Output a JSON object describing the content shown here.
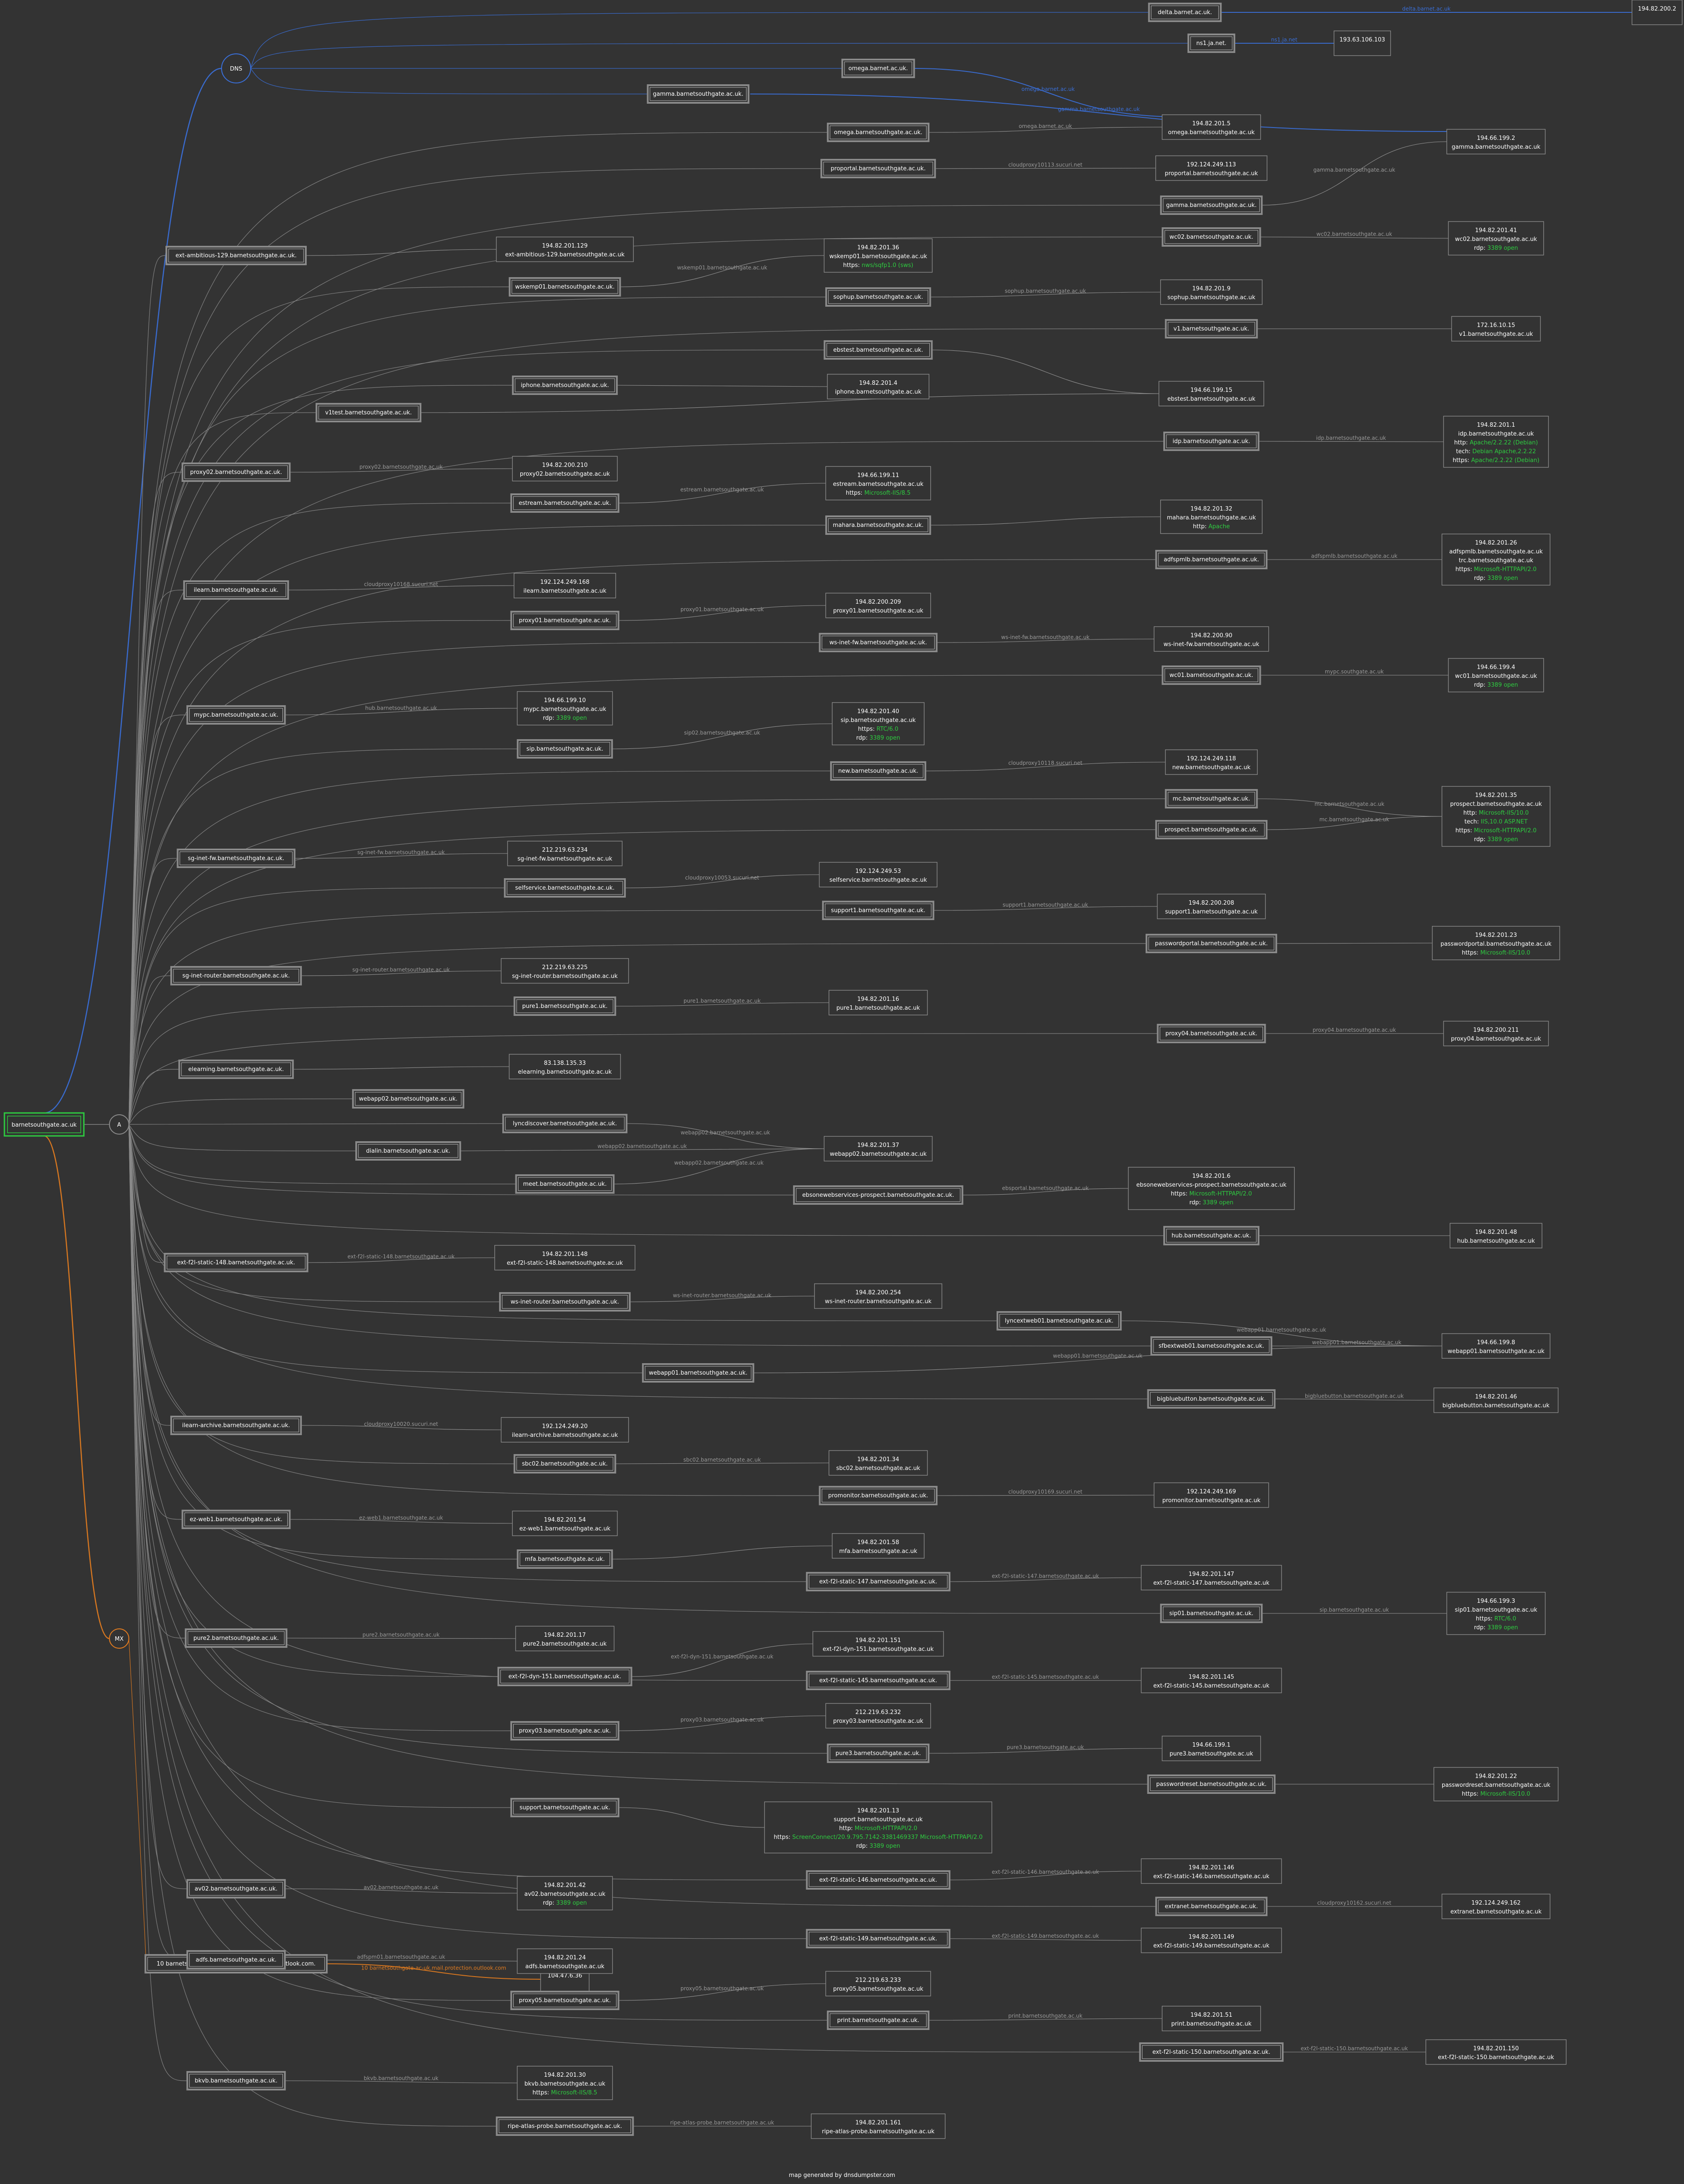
{
  "domain_root": "barnetsouthgate.ac.uk",
  "footer": "map generated by dnsdumpster.com",
  "colors": {
    "dns": "#3a6fd8",
    "mx": "#e07b20",
    "a": "#8a8a8a",
    "green": "#2ecc40",
    "text": "#ffffff",
    "label": "#9a9a9a",
    "bg": "#333333"
  },
  "dns": {
    "hub": "DNS",
    "servers": [
      {
        "host": "delta.barnet.ac.uk.",
        "link": "delta.barnet.ac.uk",
        "ip": "194.82.200.2"
      },
      {
        "host": "ns1.ja.net.",
        "link": "ns1.ja.net",
        "ip": "193.63.106.103"
      },
      {
        "host": "omega.barnet.ac.uk.",
        "link": "omega.barnet.ac.uk"
      },
      {
        "host": "gamma.barnetsouthgate.ac.uk.",
        "link": "gamma.barnetsouthgate.ac.uk"
      }
    ]
  },
  "mx": {
    "hub": "MX",
    "host": "10 barnetsouthgate-ac-uk.mail.protection.outlook.com.",
    "link": "10 barnetsouthgate-ac-uk.mail.protection.outlook.com",
    "ip": "104.47.6.36"
  },
  "a": {
    "hub": "A",
    "hosts": [
      "omega.barnetsouthgate.ac.uk.",
      "proportal.barnetsouthgate.ac.uk.",
      "gamma.barnetsouthgate.ac.uk.",
      "wc02.barnetsouthgate.ac.uk.",
      "ext-ambitious-129.barnetsouthgate.ac.uk.",
      "wskemp01.barnetsouthgate.ac.uk.",
      "sophup.barnetsouthgate.ac.uk.",
      "v1.barnetsouthgate.ac.uk.",
      "ebstest.barnetsouthgate.ac.uk.",
      "iphone.barnetsouthgate.ac.uk.",
      "v1test.barnetsouthgate.ac.uk.",
      "idp.barnetsouthgate.ac.uk.",
      "proxy02.barnetsouthgate.ac.uk.",
      "estream.barnetsouthgate.ac.uk.",
      "mahara.barnetsouthgate.ac.uk.",
      "adfspmlb.barnetsouthgate.ac.uk.",
      "ilearn.barnetsouthgate.ac.uk.",
      "proxy01.barnetsouthgate.ac.uk.",
      "ws-inet-fw.barnetsouthgate.ac.uk.",
      "wc01.barnetsouthgate.ac.uk.",
      "mypc.barnetsouthgate.ac.uk.",
      "sip.barnetsouthgate.ac.uk.",
      "new.barnetsouthgate.ac.uk.",
      "mc.barnetsouthgate.ac.uk.",
      "prospect.barnetsouthgate.ac.uk.",
      "sg-inet-fw.barnetsouthgate.ac.uk.",
      "selfservice.barnetsouthgate.ac.uk.",
      "support1.barnetsouthgate.ac.uk.",
      "passwordportal.barnetsouthgate.ac.uk.",
      "sg-inet-router.barnetsouthgate.ac.uk.",
      "pure1.barnetsouthgate.ac.uk.",
      "proxy04.barnetsouthgate.ac.uk.",
      "elearning.barnetsouthgate.ac.uk.",
      "webapp02.barnetsouthgate.ac.uk.",
      "lyncdiscover.barnetsouthgate.ac.uk.",
      "dialin.barnetsouthgate.ac.uk.",
      "meet.barnetsouthgate.ac.uk.",
      "ebsonewebservices-prospect.barnetsouthgate.ac.uk.",
      "hub.barnetsouthgate.ac.uk.",
      "ext-f2l-static-148.barnetsouthgate.ac.uk.",
      "ws-inet-router.barnetsouthgate.ac.uk.",
      "lyncextweb01.barnetsouthgate.ac.uk.",
      "sfbextweb01.barnetsouthgate.ac.uk.",
      "webapp01.barnetsouthgate.ac.uk.",
      "bigbluebutton.barnetsouthgate.ac.uk.",
      "ilearn-archive.barnetsouthgate.ac.uk.",
      "sbc02.barnetsouthgate.ac.uk.",
      "promonitor.barnetsouthgate.ac.uk.",
      "ez-web1.barnetsouthgate.ac.uk.",
      "mfa.barnetsouthgate.ac.uk.",
      "ext-f2l-static-147.barnetsouthgate.ac.uk.",
      "sip01.barnetsouthgate.ac.uk.",
      "pure2.barnetsouthgate.ac.uk.",
      "ext-f2l-dyn-151.barnetsouthgate.ac.uk.",
      "ext-f2l-static-145.barnetsouthgate.ac.uk.",
      "proxy03.barnetsouthgate.ac.uk.",
      "pure3.barnetsouthgate.ac.uk.",
      "passwordreset.barnetsouthgate.ac.uk.",
      "support.barnetsouthgate.ac.uk.",
      "ext-f2l-static-146.barnetsouthgate.ac.uk.",
      "av02.barnetsouthgate.ac.uk.",
      "extranet.barnetsouthgate.ac.uk.",
      "ext-f2l-static-149.barnetsouthgate.ac.uk.",
      "adfs.barnetsouthgate.ac.uk.",
      "proxy05.barnetsouthgate.ac.uk.",
      "print.barnetsouthgate.ac.uk.",
      "ext-f2l-static-150.barnetsouthgate.ac.uk.",
      "bkvb.barnetsouthgate.ac.uk.",
      "ripe-atlas-probe.barnetsouthgate.ac.uk."
    ],
    "ips": [
      {
        "ip": "194.82.201.5",
        "name": "omega.barnetsouthgate.ac.uk"
      },
      {
        "ip": "192.124.249.113",
        "name": "proportal.barnetsouthgate.ac.uk"
      },
      {
        "ip": "194.66.199.2",
        "name": "gamma.barnetsouthgate.ac.uk"
      },
      {
        "ip": "194.82.201.41",
        "name": "wc02.barnetsouthgate.ac.uk",
        "svc": [
          {
            "k": "rdp:",
            "v": "3389 open"
          }
        ]
      },
      {
        "ip": "194.82.201.129",
        "name": "ext-ambitious-129.barnetsouthgate.ac.uk"
      },
      {
        "ip": "194.82.201.36",
        "name": "wskemp01.barnetsouthgate.ac.uk",
        "svc": [
          {
            "k": "https:",
            "v": "nws/sqfp1.0 (sws)"
          }
        ]
      },
      {
        "ip": "194.82.201.9",
        "name": "sophup.barnetsouthgate.ac.uk"
      },
      {
        "ip": "172.16.10.15",
        "name": "v1.barnetsouthgate.ac.uk"
      },
      {
        "ip": "194.66.199.15",
        "name": "ebstest.barnetsouthgate.ac.uk"
      },
      {
        "ip": "194.82.201.4",
        "name": "iphone.barnetsouthgate.ac.uk"
      },
      {
        "ip": "194.82.201.1",
        "name": "idp.barnetsouthgate.ac.uk",
        "svc": [
          {
            "k": "http:",
            "v": "Apache/2.2.22 (Debian)"
          },
          {
            "k": "tech:",
            "v": "Debian Apache,2.2.22"
          },
          {
            "k": "https:",
            "v": "Apache/2.2.22 (Debian)"
          }
        ]
      },
      {
        "ip": "194.82.200.210",
        "name": "proxy02.barnetsouthgate.ac.uk"
      },
      {
        "ip": "194.66.199.11",
        "name": "estream.barnetsouthgate.ac.uk",
        "svc": [
          {
            "k": "https:",
            "v": "Microsoft-IIS/8.5"
          }
        ]
      },
      {
        "ip": "194.82.201.32",
        "name": "mahara.barnetsouthgate.ac.uk",
        "svc": [
          {
            "k": "http:",
            "v": "Apache"
          }
        ]
      },
      {
        "ip": "194.82.201.26",
        "name": "adfspmlb.barnetsouthgate.ac.uk",
        "name2": "trc.barnetsouthgate.ac.uk",
        "svc": [
          {
            "k": "https:",
            "v": "Microsoft-HTTPAPI/2.0"
          },
          {
            "k": "rdp:",
            "v": "3389 open"
          }
        ]
      },
      {
        "ip": "192.124.249.168",
        "name": "ilearn.barnetsouthgate.ac.uk"
      },
      {
        "ip": "194.82.200.209",
        "name": "proxy01.barnetsouthgate.ac.uk"
      },
      {
        "ip": "194.82.200.90",
        "name": "ws-inet-fw.barnetsouthgate.ac.uk"
      },
      {
        "ip": "194.66.199.4",
        "name": "wc01.barnetsouthgate.ac.uk",
        "svc": [
          {
            "k": "rdp:",
            "v": "3389 open"
          }
        ]
      },
      {
        "ip": "194.66.199.10",
        "name": "mypc.barnetsouthgate.ac.uk",
        "svc": [
          {
            "k": "rdp:",
            "v": "3389 open"
          }
        ]
      },
      {
        "ip": "194.82.201.40",
        "name": "sip.barnetsouthgate.ac.uk",
        "svc": [
          {
            "k": "https:",
            "v": "RTC/6.0"
          },
          {
            "k": "rdp:",
            "v": "3389 open"
          }
        ]
      },
      {
        "ip": "192.124.249.118",
        "name": "new.barnetsouthgate.ac.uk"
      },
      {
        "ip": "194.82.201.35",
        "name": "prospect.barnetsouthgate.ac.uk",
        "svc": [
          {
            "k": "http:",
            "v": "Microsoft-IIS/10.0"
          },
          {
            "k": "tech:",
            "v": "IIS,10.0 ASP.NET"
          },
          {
            "k": "https:",
            "v": "Microsoft-HTTPAPI/2.0"
          },
          {
            "k": "rdp:",
            "v": "3389 open"
          }
        ]
      },
      {
        "ip": "212.219.63.234",
        "name": "sg-inet-fw.barnetsouthgate.ac.uk"
      },
      {
        "ip": "192.124.249.53",
        "name": "selfservice.barnetsouthgate.ac.uk"
      },
      {
        "ip": "194.82.200.208",
        "name": "support1.barnetsouthgate.ac.uk"
      },
      {
        "ip": "194.82.201.23",
        "name": "passwordportal.barnetsouthgate.ac.uk",
        "svc": [
          {
            "k": "https:",
            "v": "Microsoft-IIS/10.0"
          }
        ]
      },
      {
        "ip": "212.219.63.225",
        "name": "sg-inet-router.barnetsouthgate.ac.uk"
      },
      {
        "ip": "194.82.201.16",
        "name": "pure1.barnetsouthgate.ac.uk"
      },
      {
        "ip": "194.82.200.211",
        "name": "proxy04.barnetsouthgate.ac.uk"
      },
      {
        "ip": "83.138.135.33",
        "name": "elearning.barnetsouthgate.ac.uk"
      },
      {
        "ip": "194.82.201.37",
        "name": "webapp02.barnetsouthgate.ac.uk"
      },
      {
        "ip": "194.82.201.6",
        "name": "ebsonewebservices-prospect.barnetsouthgate.ac.uk",
        "svc": [
          {
            "k": "https:",
            "v": "Microsoft-HTTPAPI/2.0"
          },
          {
            "k": "rdp:",
            "v": "3389 open"
          }
        ]
      },
      {
        "ip": "194.82.201.48",
        "name": "hub.barnetsouthgate.ac.uk"
      },
      {
        "ip": "194.82.201.148",
        "name": "ext-f2l-static-148.barnetsouthgate.ac.uk"
      },
      {
        "ip": "194.82.200.254",
        "name": "ws-inet-router.barnetsouthgate.ac.uk"
      },
      {
        "ip": "194.66.199.8",
        "name": "webapp01.barnetsouthgate.ac.uk"
      },
      {
        "ip": "194.82.201.46",
        "name": "bigbluebutton.barnetsouthgate.ac.uk"
      },
      {
        "ip": "192.124.249.20",
        "name": "ilearn-archive.barnetsouthgate.ac.uk"
      },
      {
        "ip": "194.82.201.34",
        "name": "sbc02.barnetsouthgate.ac.uk"
      },
      {
        "ip": "192.124.249.169",
        "name": "promonitor.barnetsouthgate.ac.uk"
      },
      {
        "ip": "194.82.201.54",
        "name": "ez-web1.barnetsouthgate.ac.uk"
      },
      {
        "ip": "194.82.201.58",
        "name": "mfa.barnetsouthgate.ac.uk"
      },
      {
        "ip": "194.82.201.147",
        "name": "ext-f2l-static-147.barnetsouthgate.ac.uk"
      },
      {
        "ip": "194.66.199.3",
        "name": "sip01.barnetsouthgate.ac.uk",
        "svc": [
          {
            "k": "https:",
            "v": "RTC/6.0"
          },
          {
            "k": "rdp:",
            "v": "3389 open"
          }
        ]
      },
      {
        "ip": "194.82.201.17",
        "name": "pure2.barnetsouthgate.ac.uk"
      },
      {
        "ip": "194.82.201.151",
        "name": "ext-f2l-dyn-151.barnetsouthgate.ac.uk"
      },
      {
        "ip": "194.82.201.145",
        "name": "ext-f2l-static-145.barnetsouthgate.ac.uk"
      },
      {
        "ip": "212.219.63.232",
        "name": "proxy03.barnetsouthgate.ac.uk"
      },
      {
        "ip": "194.66.199.1",
        "name": "pure3.barnetsouthgate.ac.uk"
      },
      {
        "ip": "194.82.201.22",
        "name": "passwordreset.barnetsouthgate.ac.uk",
        "svc": [
          {
            "k": "https:",
            "v": "Microsoft-IIS/10.0"
          }
        ]
      },
      {
        "ip": "194.82.201.13",
        "name": "support.barnetsouthgate.ac.uk",
        "svc": [
          {
            "k": "http:",
            "v": "Microsoft-HTTPAPI/2.0"
          },
          {
            "k": "https:",
            "v": "ScreenConnect/20.9.795.7142-3381469337 Microsoft-HTTPAPI/2.0"
          },
          {
            "k": "rdp:",
            "v": "3389 open"
          }
        ]
      },
      {
        "ip": "194.82.201.146",
        "name": "ext-f2l-static-146.barnetsouthgate.ac.uk"
      },
      {
        "ip": "194.82.201.42",
        "name": "av02.barnetsouthgate.ac.uk",
        "svc": [
          {
            "k": "rdp:",
            "v": "3389 open"
          }
        ]
      },
      {
        "ip": "192.124.249.162",
        "name": "extranet.barnetsouthgate.ac.uk"
      },
      {
        "ip": "194.82.201.149",
        "name": "ext-f2l-static-149.barnetsouthgate.ac.uk"
      },
      {
        "ip": "194.82.201.24",
        "name": "adfs.barnetsouthgate.ac.uk"
      },
      {
        "ip": "212.219.63.233",
        "name": "proxy05.barnetsouthgate.ac.uk"
      },
      {
        "ip": "194.82.201.51",
        "name": "print.barnetsouthgate.ac.uk"
      },
      {
        "ip": "194.82.201.150",
        "name": "ext-f2l-static-150.barnetsouthgate.ac.uk"
      },
      {
        "ip": "194.82.201.30",
        "name": "bkvb.barnetsouthgate.ac.uk",
        "svc": [
          {
            "k": "https:",
            "v": "Microsoft-IIS/8.5"
          }
        ]
      },
      {
        "ip": "194.82.201.161",
        "name": "ripe-atlas-probe.barnetsouthgate.ac.uk"
      }
    ],
    "links": [
      "omega.barnet.ac.uk",
      "cloudproxy10113.sucuri.net",
      "gamma.barnetsouthgate.ac.uk",
      "wc02.barnetsouthgate.ac.uk",
      "wskemp01.barnetsouthgate.ac.uk",
      "sophup.barnetsouthgate.ac.uk",
      "idp.barnetsouthgate.ac.uk",
      "proxy02.barnetsouthgate.ac.uk",
      "estream.barnetsouthgate.ac.uk",
      "adfspmlb.barnetsouthgate.ac.uk",
      "cloudproxy10168.sucuri.net",
      "proxy01.barnetsouthgate.ac.uk",
      "ws-inet-fw.barnetsouthgate.ac.uk",
      "mypc.southgate.ac.uk",
      "hub.barnetsouthgate.ac.uk",
      "sip02.barnetsouthgate.ac.uk",
      "cloudproxy10118.sucuri.net",
      "mc.barnetsouthgate.ac.uk",
      "mc.barnetsouthgate.ac.uk",
      "sg-inet-fw.barnetsouthgate.ac.uk",
      "cloudproxy10053.sucuri.net",
      "support1.barnetsouthgate.ac.uk",
      "sg-inet-router.barnetsouthgate.ac.uk",
      "pure1.barnetsouthgate.ac.uk",
      "proxy04.barnetsouthgate.ac.uk",
      "webapp02.barnetsouthgate.ac.uk",
      "webapp02.barnetsouthgate.ac.uk",
      "webapp02.barnetsouthgate.ac.uk",
      "ebsportal.barnetsouthgate.ac.uk",
      "ext-f2l-static-148.barnetsouthgate.ac.uk",
      "ws-inet-router.barnetsouthgate.ac.uk",
      "webapp01.barnetsouthgate.ac.uk",
      "webapp01.barnetsouthgate.ac.uk",
      "webapp01.barnetsouthgate.ac.uk",
      "bigbluebutton.barnetsouthgate.ac.uk",
      "cloudproxy10020.sucuri.net",
      "sbc02.barnetsouthgate.ac.uk",
      "cloudproxy10169.sucuri.net",
      "ez-web1.barnetsouthgate.ac.uk",
      "ext-f2l-static-147.barnetsouthgate.ac.uk",
      "sip.barnetsouthgate.ac.uk",
      "pure2.barnetsouthgate.ac.uk",
      "ext-f2l-dyn-151.barnetsouthgate.ac.uk",
      "ext-f2l-static-145.barnetsouthgate.ac.uk",
      "proxy03.barnetsouthgate.ac.uk",
      "pure3.barnetsouthgate.ac.uk",
      "ext-f2l-static-146.barnetsouthgate.ac.uk",
      "av02.barnetsouthgate.ac.uk",
      "cloudproxy10162.sucuri.net",
      "ext-f2l-static-149.barnetsouthgate.ac.uk",
      "adfspm01.barnetsouthgate.ac.uk",
      "proxy05.barnetsouthgate.ac.uk",
      "print.barnetsouthgate.ac.uk",
      "ext-f2l-static-150.barnetsouthgate.ac.uk",
      "bkvb.barnetsouthgate.ac.uk",
      "ripe-atlas-probe.barnetsouthgate.ac.uk"
    ]
  }
}
